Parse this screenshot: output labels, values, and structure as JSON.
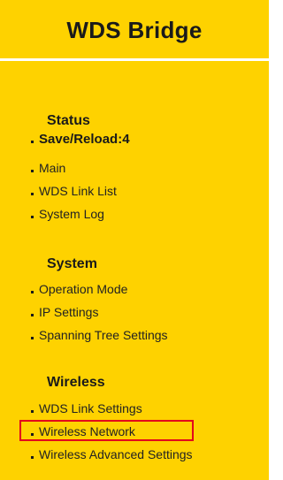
{
  "header": {
    "title": "WDS Bridge"
  },
  "sections": [
    {
      "title": "Status",
      "items": [
        {
          "label": "Save/Reload:4"
        },
        {
          "label": "Main"
        },
        {
          "label": "WDS Link List"
        },
        {
          "label": "System Log"
        }
      ]
    },
    {
      "title": "System",
      "items": [
        {
          "label": "Operation Mode"
        },
        {
          "label": "IP Settings"
        },
        {
          "label": "Spanning Tree Settings"
        }
      ]
    },
    {
      "title": "Wireless",
      "items": [
        {
          "label": "WDS Link Settings"
        },
        {
          "label": "Wireless Network"
        },
        {
          "label": "Wireless Advanced Settings"
        }
      ]
    }
  ],
  "colors": {
    "panel_background": "#FED200",
    "divider": "#FFFFFF",
    "highlight_border": "#E3001B"
  },
  "icons": {
    "bullet": "square-bullet-icon"
  }
}
